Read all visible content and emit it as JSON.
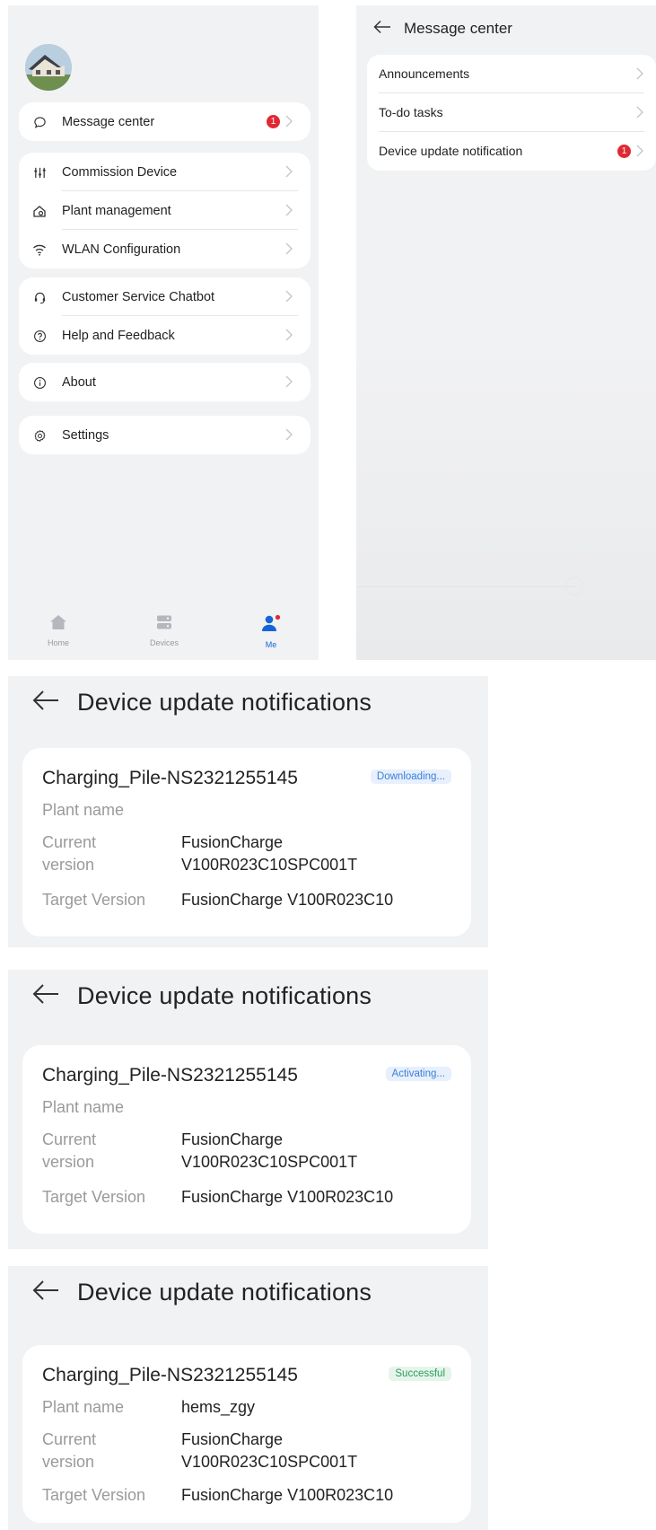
{
  "me_screen": {
    "items_group1": [
      {
        "label": "Message center",
        "icon": "chat-bubble-icon",
        "badge": "1"
      }
    ],
    "items_group2": [
      {
        "label": "Commission Device",
        "icon": "sliders-icon"
      },
      {
        "label": "Plant management",
        "icon": "house-gear-icon"
      },
      {
        "label": "WLAN Configuration",
        "icon": "wifi-icon"
      }
    ],
    "items_group3": [
      {
        "label": "Customer Service Chatbot",
        "icon": "headset-icon"
      },
      {
        "label": "Help and Feedback",
        "icon": "question-circle-icon"
      }
    ],
    "items_group4": [
      {
        "label": "About",
        "icon": "info-circle-icon"
      }
    ],
    "items_group5": [
      {
        "label": "Settings",
        "icon": "gear-icon"
      }
    ],
    "tabbar": [
      {
        "label": "Home",
        "icon": "home-icon"
      },
      {
        "label": "Devices",
        "icon": "devices-icon"
      },
      {
        "label": "Me",
        "icon": "person-icon",
        "active": true
      }
    ],
    "accent_color": "#1565d8",
    "badge_color": "#e02a33"
  },
  "message_center": {
    "title": "Message center",
    "items": [
      {
        "label": "Announcements"
      },
      {
        "label": "To-do tasks"
      },
      {
        "label": "Device update notification",
        "badge": "1"
      }
    ]
  },
  "update_screens": [
    {
      "title": "Device update notifications",
      "device": "Charging_Pile-NS2321255145",
      "status": "Downloading...",
      "status_color": "blue",
      "plant_name_label": "Plant name",
      "plant_name_value": "",
      "current_version_label": [
        "Current",
        "version"
      ],
      "current_version_value": [
        "FusionCharge",
        "V100R023C10SPC001T"
      ],
      "target_version_label": "Target Version",
      "target_version_value": "FusionCharge V100R023C10"
    },
    {
      "title": "Device update notifications",
      "device": "Charging_Pile-NS2321255145",
      "status": "Activating...",
      "status_color": "blue",
      "plant_name_label": "Plant name",
      "plant_name_value": "",
      "current_version_label": [
        "Current",
        "version"
      ],
      "current_version_value": [
        "FusionCharge",
        "V100R023C10SPC001T"
      ],
      "target_version_label": "Target Version",
      "target_version_value": "FusionCharge V100R023C10"
    },
    {
      "title": "Device update notifications",
      "device": "Charging_Pile-NS2321255145",
      "status": "Successful",
      "status_color": "green",
      "plant_name_label": "Plant name",
      "plant_name_value": "hems_zgy",
      "current_version_label": [
        "Current",
        "version"
      ],
      "current_version_value": [
        "FusionCharge",
        "V100R023C10SPC001T"
      ],
      "target_version_label": "Target Version",
      "target_version_value": "FusionCharge V100R023C10"
    }
  ]
}
